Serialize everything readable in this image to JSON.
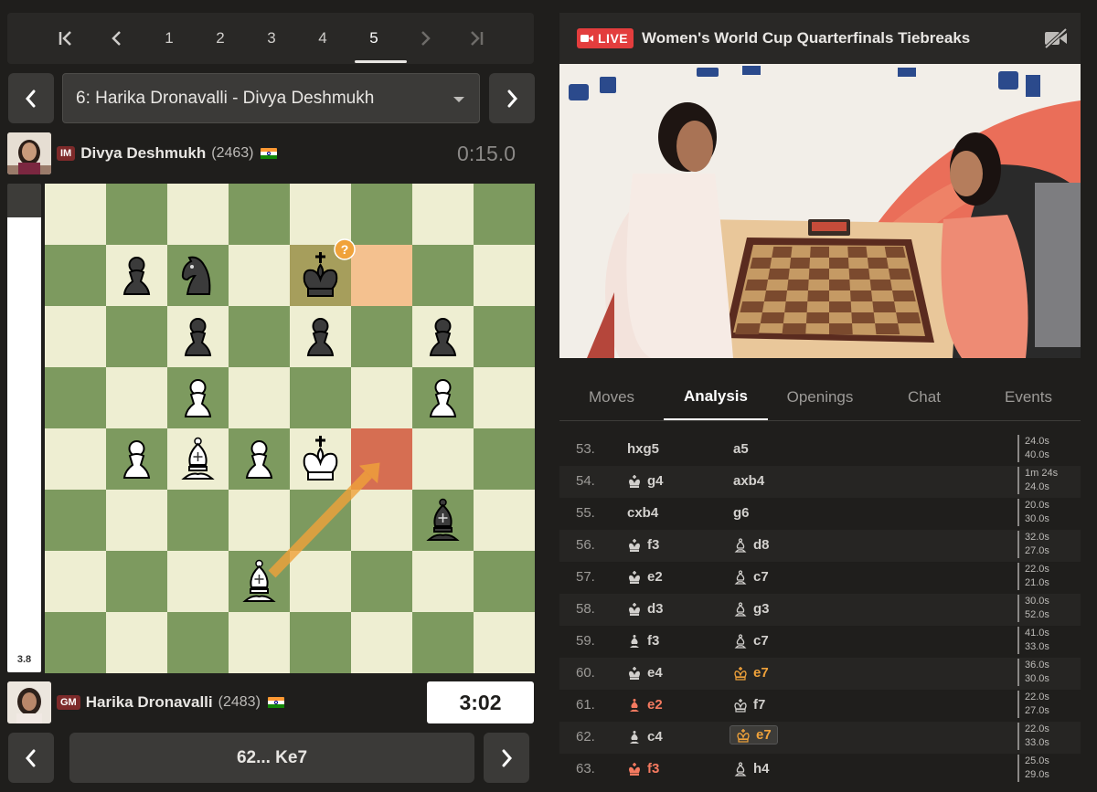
{
  "round_nav": {
    "rounds": [
      "1",
      "2",
      "3",
      "4",
      "5"
    ],
    "active": "5"
  },
  "game_select": {
    "label": "6: Harika Dronavalli - Divya Deshmukh"
  },
  "top_player": {
    "title": "IM",
    "name": "Divya Deshmukh",
    "rating": "(2463)",
    "clock": "0:15.0"
  },
  "bottom_player": {
    "title": "GM",
    "name": "Harika Dronavalli",
    "rating": "(2483)",
    "clock": "3:02"
  },
  "eval": {
    "value": "3.8",
    "white_fraction": 0.93
  },
  "annotation": {
    "symbol": "?"
  },
  "current_move": {
    "label": "62... Ke7"
  },
  "broadcast": {
    "live_label": "LIVE",
    "title": "Women's World Cup Quarterfinals Tiebreaks"
  },
  "tabs": [
    "Moves",
    "Analysis",
    "Openings",
    "Chat",
    "Events"
  ],
  "active_tab": "Analysis",
  "moves": [
    {
      "num": "53.",
      "w": "hxg5",
      "wp": "",
      "b": "a5",
      "bp": "",
      "t1": "24.0s",
      "t2": "40.0s"
    },
    {
      "num": "54.",
      "w": "g4",
      "wp": "K",
      "b": "axb4",
      "bp": "",
      "t1": "1m 24s",
      "t2": "24.0s"
    },
    {
      "num": "55.",
      "w": "cxb4",
      "wp": "",
      "b": "g6",
      "bp": "",
      "t1": "20.0s",
      "t2": "30.0s"
    },
    {
      "num": "56.",
      "w": "f3",
      "wp": "K",
      "b": "d8",
      "bp": "b",
      "t1": "32.0s",
      "t2": "27.0s"
    },
    {
      "num": "57.",
      "w": "e2",
      "wp": "K",
      "b": "c7",
      "bp": "b",
      "t1": "22.0s",
      "t2": "21.0s"
    },
    {
      "num": "58.",
      "w": "d3",
      "wp": "K",
      "b": "g3",
      "bp": "b",
      "t1": "30.0s",
      "t2": "52.0s"
    },
    {
      "num": "59.",
      "w": "f3",
      "wp": "B",
      "b": "c7",
      "bp": "b",
      "t1": "41.0s",
      "t2": "33.0s"
    },
    {
      "num": "60.",
      "w": "e4",
      "wp": "K",
      "b": "e7",
      "bp": "k",
      "bclass": "mistake",
      "t1": "36.0s",
      "t2": "30.0s"
    },
    {
      "num": "61.",
      "w": "e2",
      "wp": "B",
      "wclass": "blunder",
      "b": "f7",
      "bp": "k",
      "t1": "22.0s",
      "t2": "27.0s"
    },
    {
      "num": "62.",
      "w": "c4",
      "wp": "B",
      "b": "e7",
      "bp": "k",
      "bclass": "mistake",
      "bhl": true,
      "t1": "22.0s",
      "t2": "33.0s"
    },
    {
      "num": "63.",
      "w": "f3",
      "wp": "K",
      "wclass": "blunder",
      "b": "h4",
      "bp": "b",
      "t1": "25.0s",
      "t2": "29.0s"
    }
  ],
  "board": {
    "light": "#eeeed2",
    "dark": "#7d9a5f",
    "highlight_from": "#f4c18f",
    "highlight_to": "#d66e52",
    "arrow": "#f0a23a",
    "pieces": [
      {
        "sq": "b7",
        "p": "bp"
      },
      {
        "sq": "c7",
        "p": "bn"
      },
      {
        "sq": "e7",
        "p": "bk"
      },
      {
        "sq": "c6",
        "p": "bp"
      },
      {
        "sq": "e6",
        "p": "bp"
      },
      {
        "sq": "g6",
        "p": "bp"
      },
      {
        "sq": "c5",
        "p": "wp"
      },
      {
        "sq": "g5",
        "p": "wp"
      },
      {
        "sq": "b4",
        "p": "wp"
      },
      {
        "sq": "c4",
        "p": "wb"
      },
      {
        "sq": "d4",
        "p": "wp"
      },
      {
        "sq": "e4",
        "p": "wk"
      },
      {
        "sq": "g3",
        "p": "bb"
      },
      {
        "sq": "d2",
        "p": "wb"
      }
    ],
    "last_move_from": "e7",
    "last_move_from2": "f7",
    "arrow_from": "d2",
    "arrow_to": "f4"
  }
}
